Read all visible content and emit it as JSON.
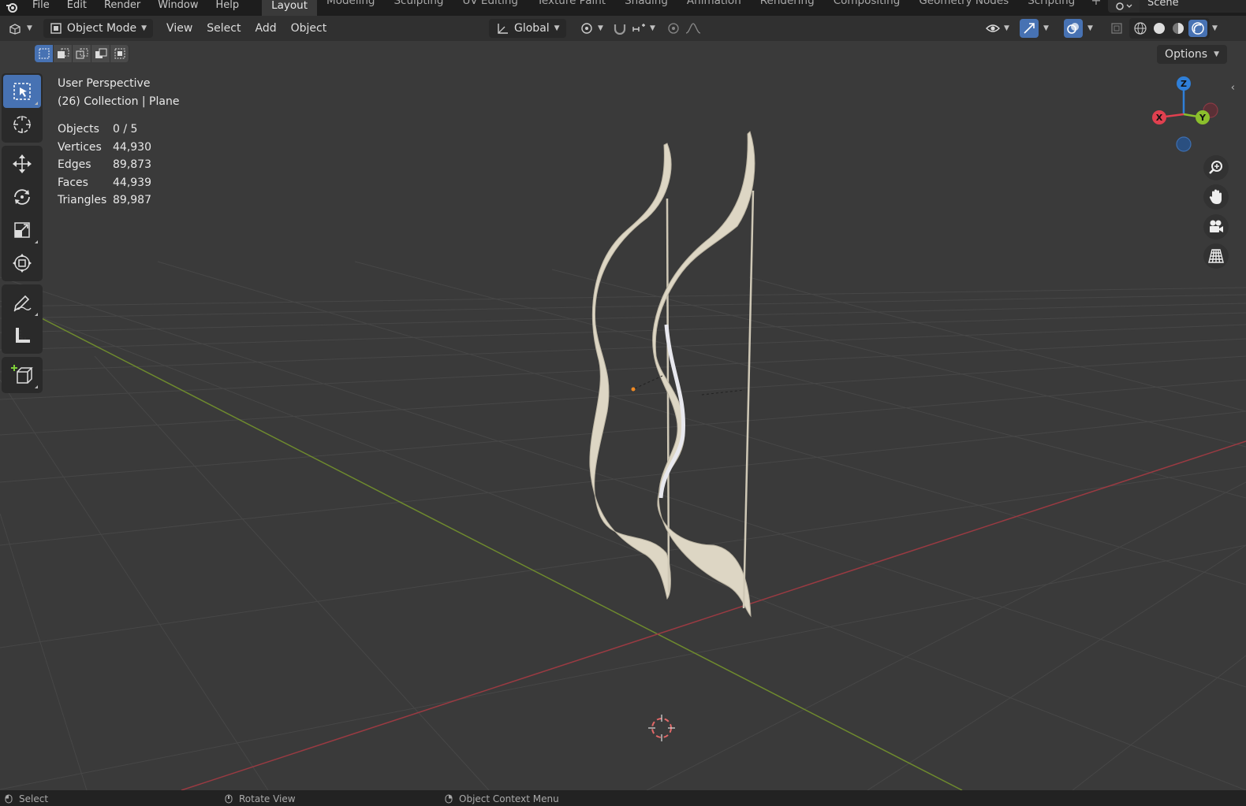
{
  "topbar": {
    "menus": [
      "File",
      "Edit",
      "Render",
      "Window",
      "Help"
    ],
    "workspaces": [
      "Layout",
      "Modeling",
      "Sculpting",
      "UV Editing",
      "Texture Paint",
      "Shading",
      "Animation",
      "Rendering",
      "Compositing",
      "Geometry Nodes",
      "Scripting"
    ],
    "active_workspace": "Layout",
    "scene_name": "Scene"
  },
  "header": {
    "mode": "Object Mode",
    "menus": [
      "View",
      "Select",
      "Add",
      "Object"
    ],
    "transform_orientation": "Global",
    "options_label": "Options"
  },
  "viewport": {
    "view_name": "User Perspective",
    "collection_info": "(26) Collection | Plane",
    "stats": [
      {
        "label": "Objects",
        "value": "0 / 5"
      },
      {
        "label": "Vertices",
        "value": "44,930"
      },
      {
        "label": "Edges",
        "value": "89,873"
      },
      {
        "label": "Faces",
        "value": "44,939"
      },
      {
        "label": "Triangles",
        "value": "89,987"
      }
    ],
    "gizmo_axes": [
      "Z",
      "X",
      "Y"
    ]
  },
  "statusbar": {
    "items": [
      "Select",
      "Rotate View",
      "Object Context Menu"
    ]
  },
  "colors": {
    "accent": "#4772b3",
    "x_axis": "#e0404f",
    "y_axis": "#8bbf2c",
    "z_axis": "#2f7fd8",
    "bow": "#ddd6c4"
  }
}
